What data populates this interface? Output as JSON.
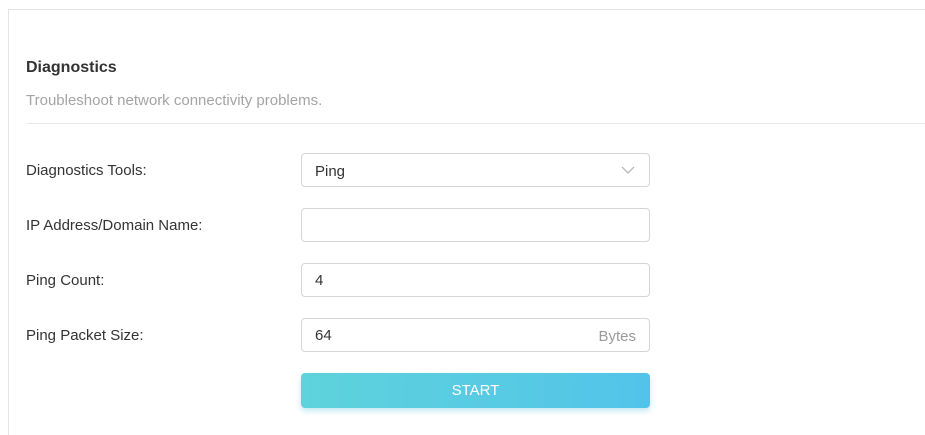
{
  "header": {
    "title": "Diagnostics",
    "subtitle": "Troubleshoot network connectivity problems."
  },
  "form": {
    "tools": {
      "label": "Diagnostics Tools:",
      "value": "Ping",
      "icon": "chevron-down-icon"
    },
    "address": {
      "label": "IP Address/Domain Name:",
      "value": "",
      "placeholder": ""
    },
    "ping_count": {
      "label": "Ping Count:",
      "value": "4"
    },
    "packet_size": {
      "label": "Ping Packet Size:",
      "value": "64",
      "suffix": "Bytes"
    },
    "start_label": "START"
  },
  "colors": {
    "accent_start": "#5ed3dc",
    "accent_end": "#52c4ea",
    "text": "#333333",
    "muted": "#a4a4a4"
  }
}
